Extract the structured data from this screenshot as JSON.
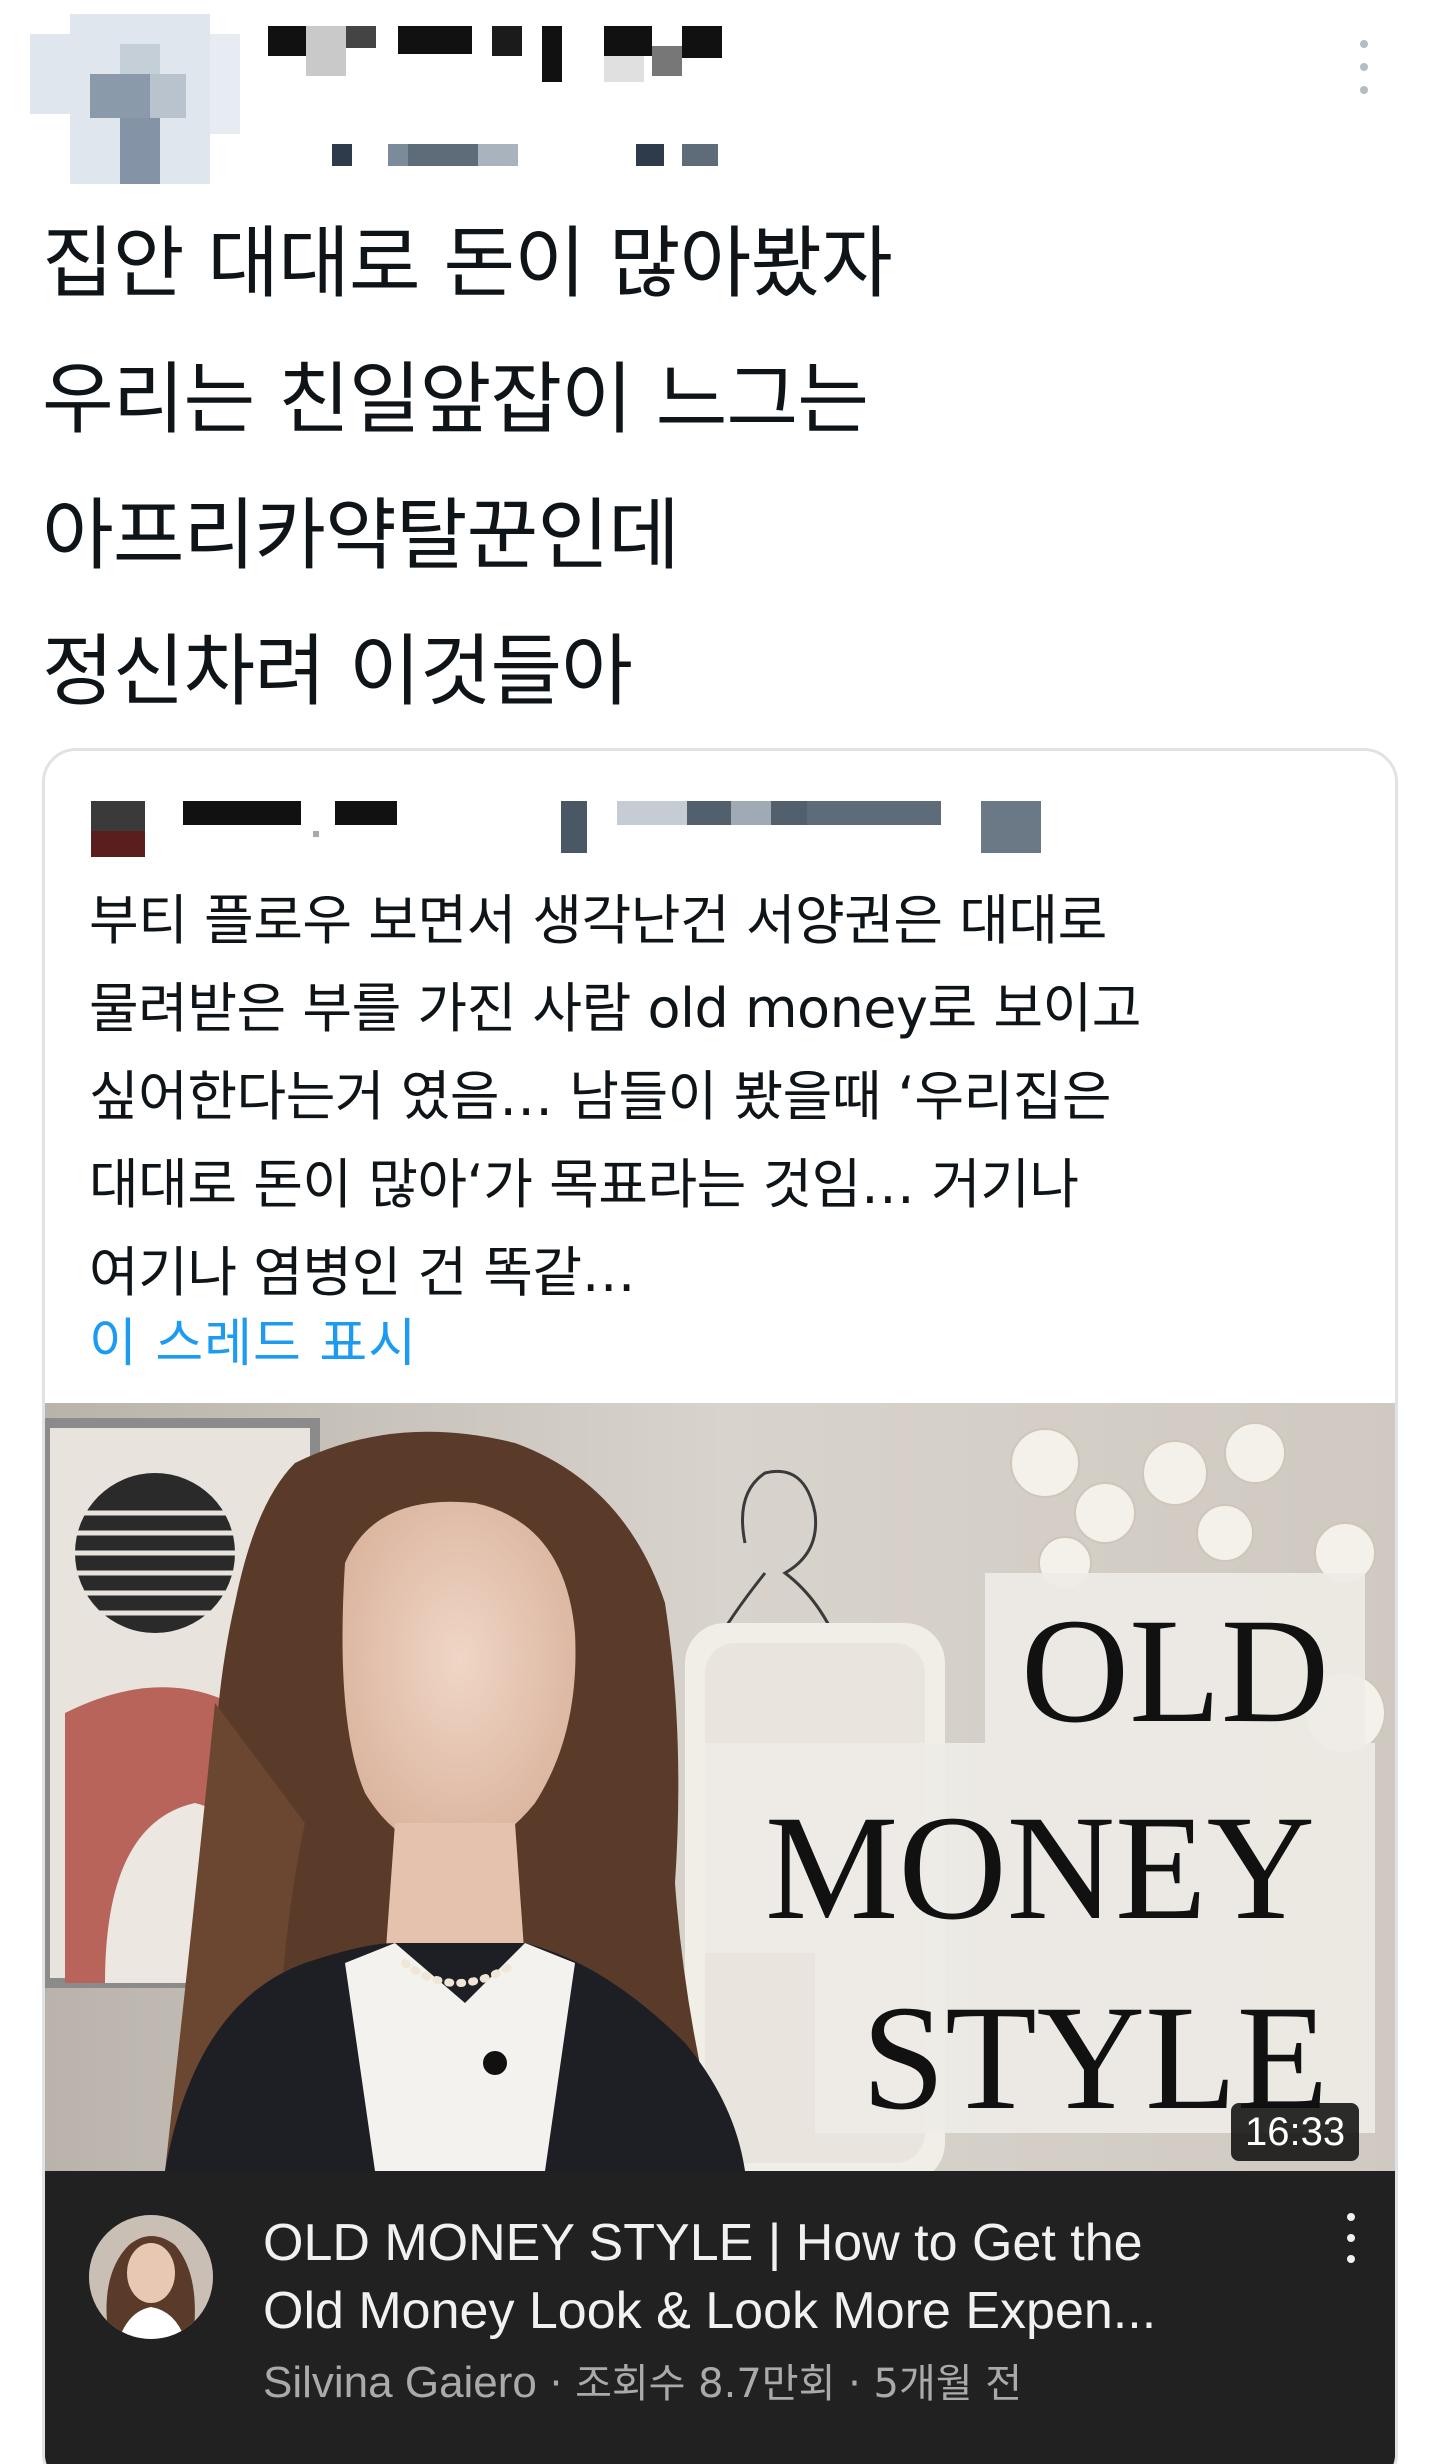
{
  "tweet": {
    "lines": [
      "집안 대대로 돈이 많아봤자",
      "우리는 친일앞잡이 느그는",
      "아프리카약탈꾼인데",
      "정신차려 이것들아"
    ]
  },
  "quote": {
    "lines": [
      "부티 플로우 보면서 생각난건 서양권은 대대로",
      "물려받은 부를 가진 사람 old money로 보이고",
      "싶어한다는거 였음… 남들이 봤을때 ‘우리집은",
      "대대로 돈이 많아‘가 목표라는 것임… 거기나",
      "여기나 염병인 건 똑같…"
    ],
    "show_thread": "이 스레드 표시"
  },
  "video": {
    "thumb_text": [
      "OLD",
      "MONEY",
      "STYLE"
    ],
    "duration": "16:33",
    "title_lines": [
      "OLD MONEY STYLE | How to Get the",
      "Old Money Look & Look More Expen..."
    ],
    "channel": "Silvina Gaiero",
    "views": "조회수 8.7만회",
    "age": "5개월 전",
    "separator": "·"
  },
  "icons": {
    "more_top": "more-vertical-icon",
    "more_video": "more-vertical-icon"
  },
  "colors": {
    "link": "#1d9bf0",
    "card_border": "#dfe3e6",
    "yt_bar": "#212121"
  }
}
